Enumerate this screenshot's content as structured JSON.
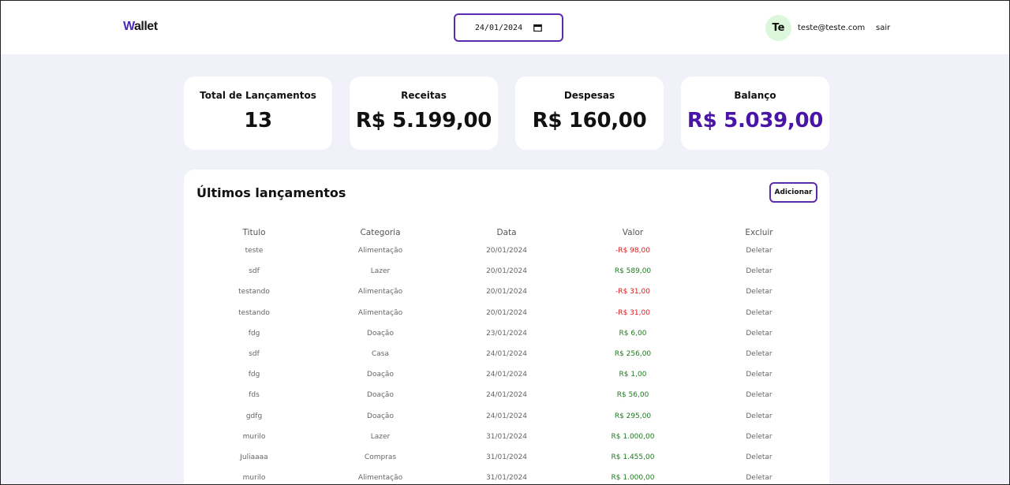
{
  "header": {
    "logo_first": "W",
    "logo_rest": "allet",
    "date_value": "24/01/2024",
    "avatar_initials": "Te",
    "email": "teste@teste.com",
    "logout_label": "sair"
  },
  "summary": [
    {
      "label": "Total de Lançamentos",
      "value": "13"
    },
    {
      "label": "Receitas",
      "value": "R$ 5.199,00"
    },
    {
      "label": "Despesas",
      "value": "R$ 160,00"
    },
    {
      "label": "Balanço",
      "value": "R$ 5.039,00"
    }
  ],
  "panel": {
    "title": "Últimos lançamentos",
    "add_label": "Adicionar"
  },
  "table": {
    "headers": [
      "Titulo",
      "Categoria",
      "Data",
      "Valor",
      "Excluir"
    ],
    "rows": [
      {
        "titulo": "teste",
        "categoria": "Alimentação",
        "data": "20/01/2024",
        "valor": "-R$ 98,00",
        "tipo": "neg",
        "acao": "Deletar"
      },
      {
        "titulo": "sdf",
        "categoria": "Lazer",
        "data": "20/01/2024",
        "valor": "R$ 589,00",
        "tipo": "pos",
        "acao": "Deletar"
      },
      {
        "titulo": "testando",
        "categoria": "Alimentação",
        "data": "20/01/2024",
        "valor": "-R$ 31,00",
        "tipo": "neg",
        "acao": "Deletar"
      },
      {
        "titulo": "testando",
        "categoria": "Alimentação",
        "data": "20/01/2024",
        "valor": "-R$ 31,00",
        "tipo": "neg",
        "acao": "Deletar"
      },
      {
        "titulo": "fdg",
        "categoria": "Doação",
        "data": "23/01/2024",
        "valor": "R$ 6,00",
        "tipo": "pos",
        "acao": "Deletar"
      },
      {
        "titulo": "sdf",
        "categoria": "Casa",
        "data": "24/01/2024",
        "valor": "R$ 256,00",
        "tipo": "pos",
        "acao": "Deletar"
      },
      {
        "titulo": "fdg",
        "categoria": "Doação",
        "data": "24/01/2024",
        "valor": "R$ 1,00",
        "tipo": "pos",
        "acao": "Deletar"
      },
      {
        "titulo": "fds",
        "categoria": "Doação",
        "data": "24/01/2024",
        "valor": "R$ 56,00",
        "tipo": "pos",
        "acao": "Deletar"
      },
      {
        "titulo": "gdfg",
        "categoria": "Doação",
        "data": "24/01/2024",
        "valor": "R$ 295,00",
        "tipo": "pos",
        "acao": "Deletar"
      },
      {
        "titulo": "murilo",
        "categoria": "Lazer",
        "data": "31/01/2024",
        "valor": "R$ 1.000,00",
        "tipo": "pos",
        "acao": "Deletar"
      },
      {
        "titulo": "Juliaaaa",
        "categoria": "Compras",
        "data": "31/01/2024",
        "valor": "R$ 1.455,00",
        "tipo": "pos",
        "acao": "Deletar"
      },
      {
        "titulo": "murilo",
        "categoria": "Alimentação",
        "data": "31/01/2024",
        "valor": "R$ 1.000,00",
        "tipo": "pos",
        "acao": "Deletar"
      }
    ]
  },
  "colors": {
    "accent": "#5b2bb0",
    "balance": "#4a14a8",
    "negative": "#d81b1b",
    "positive": "#1f7a1f",
    "background": "#f1f2f9",
    "avatar_bg": "#dcf7db"
  },
  "icons": {
    "calendar": "calendar-icon"
  }
}
